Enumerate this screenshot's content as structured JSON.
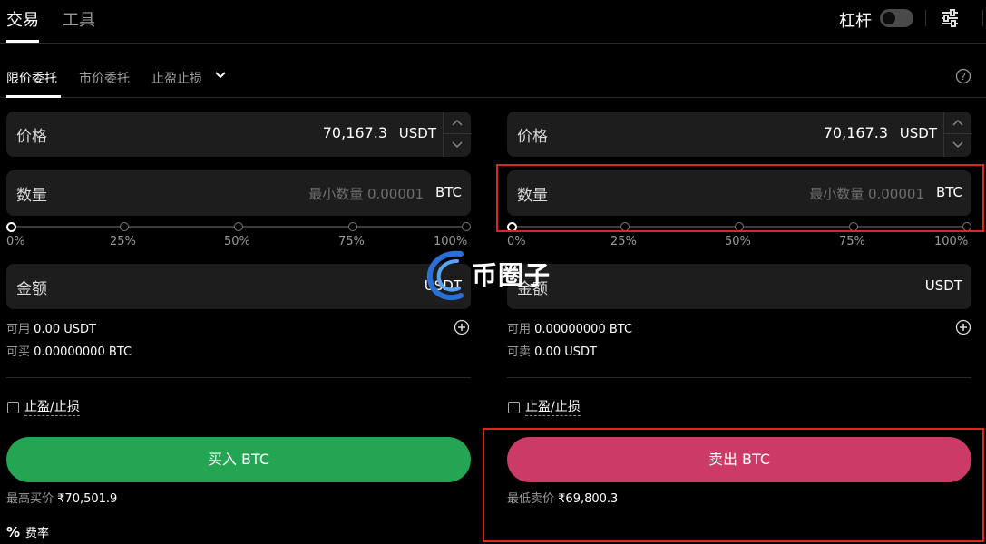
{
  "top_tabs": [
    {
      "label": "交易",
      "active": true
    },
    {
      "label": "工具",
      "active": false
    }
  ],
  "leverage": {
    "label": "杠杆",
    "enabled": false
  },
  "sub_tabs": [
    {
      "label": "限价委托",
      "active": true
    },
    {
      "label": "市价委托",
      "active": false
    },
    {
      "label": "止盈止损",
      "active": false
    }
  ],
  "buy": {
    "price_label": "价格",
    "price_value": "70,167.3",
    "price_unit": "USDT",
    "qty_label": "数量",
    "qty_placeholder": "最小数量 0.00001",
    "qty_unit": "BTC",
    "slider_marks": [
      "0%",
      "25%",
      "50%",
      "75%",
      "100%"
    ],
    "slider_value": 0,
    "amount_label": "金额",
    "amount_unit": "USDT",
    "available_label": "可用",
    "available_value": "0.00 USDT",
    "can_buy_label": "可买",
    "can_buy_value": "0.00000000 BTC",
    "tpsl_label": "止盈/止损",
    "button_label": "买入 BTC",
    "best_price_label": "最高买价",
    "best_price_value": "₹70,501.9"
  },
  "sell": {
    "price_label": "价格",
    "price_value": "70,167.3",
    "price_unit": "USDT",
    "qty_label": "数量",
    "qty_placeholder": "最小数量 0.00001",
    "qty_unit": "BTC",
    "slider_marks": [
      "0%",
      "25%",
      "50%",
      "75%",
      "100%"
    ],
    "slider_value": 0,
    "amount_label": "金额",
    "amount_unit": "USDT",
    "available_label": "可用",
    "available_value": "0.00000000 BTC",
    "can_sell_label": "可卖",
    "can_sell_value": "0.00 USDT",
    "tpsl_label": "止盈/止损",
    "button_label": "卖出 BTC",
    "best_price_label": "最低卖价",
    "best_price_value": "₹69,800.3"
  },
  "fee_label": "费率",
  "watermark": "币圈子",
  "colors": {
    "buy": "#23a553",
    "sell": "#cc3b65",
    "highlight_box": "#e0241f",
    "field_bg": "#1d1d1d"
  }
}
